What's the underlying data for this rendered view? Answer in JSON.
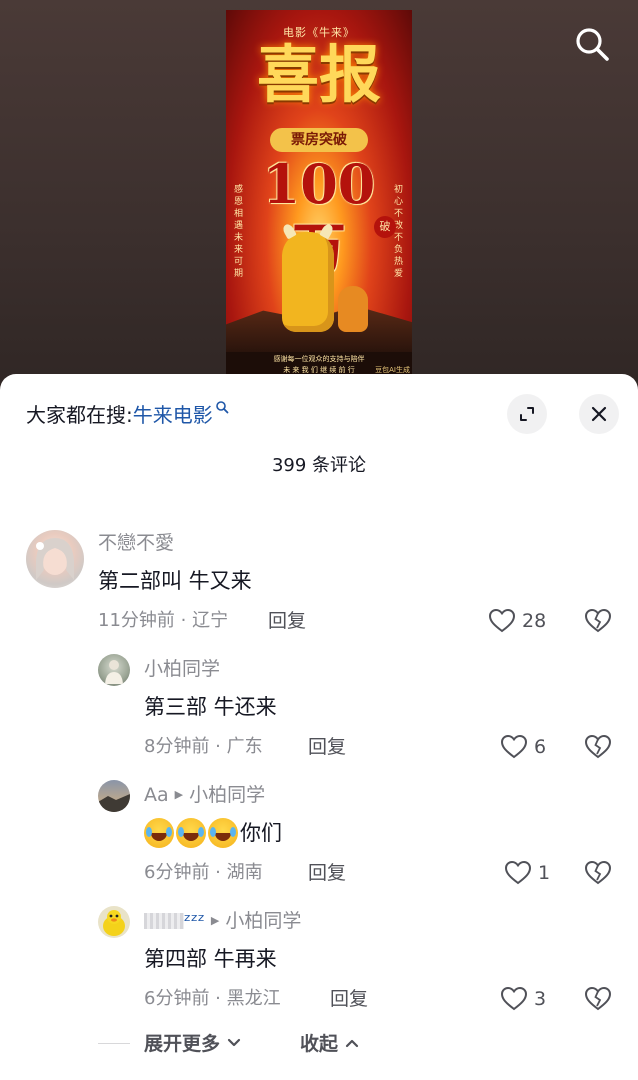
{
  "poster": {
    "top_line": "电影《牛来》",
    "headline": "喜报",
    "banner": "票房突破",
    "big_number": "100万",
    "side_left": "感恩相遇 未来可期",
    "side_right": "初心不改 不负热爱",
    "stamp": "破",
    "footer_line1": "感谢每一位观众的支持与陪伴",
    "footer_line2": "未 来 我 们 继 续 前 行",
    "watermark": "豆包AI生成"
  },
  "header": {
    "hot_search_prefix": "大家都在搜:",
    "hot_search_term": "牛来电影",
    "comment_count": "399 条评论"
  },
  "comments": [
    {
      "username": "不戀不愛",
      "text": "第二部叫 牛又来",
      "time_location": "11分钟前 · 辽宁",
      "reply_label": "回复",
      "likes": "28"
    }
  ],
  "replies": [
    {
      "username": "小柏同学",
      "text": "第三部 牛还来",
      "time_location": "8分钟前 · 广东",
      "reply_label": "回复",
      "likes": "6"
    },
    {
      "username": "Aa",
      "reply_to": "小柏同学",
      "text": "你们",
      "time_location": "6分钟前 · 湖南",
      "reply_label": "回复",
      "likes": "1"
    },
    {
      "username": "ᶻᶻᶻ",
      "reply_to": "小柏同学",
      "text": "第四部 牛再来",
      "time_location": "6分钟前 · 黑龙江",
      "reply_label": "回复",
      "likes": "3"
    }
  ],
  "footer": {
    "expand_more": "展开更多",
    "collapse": "收起"
  }
}
